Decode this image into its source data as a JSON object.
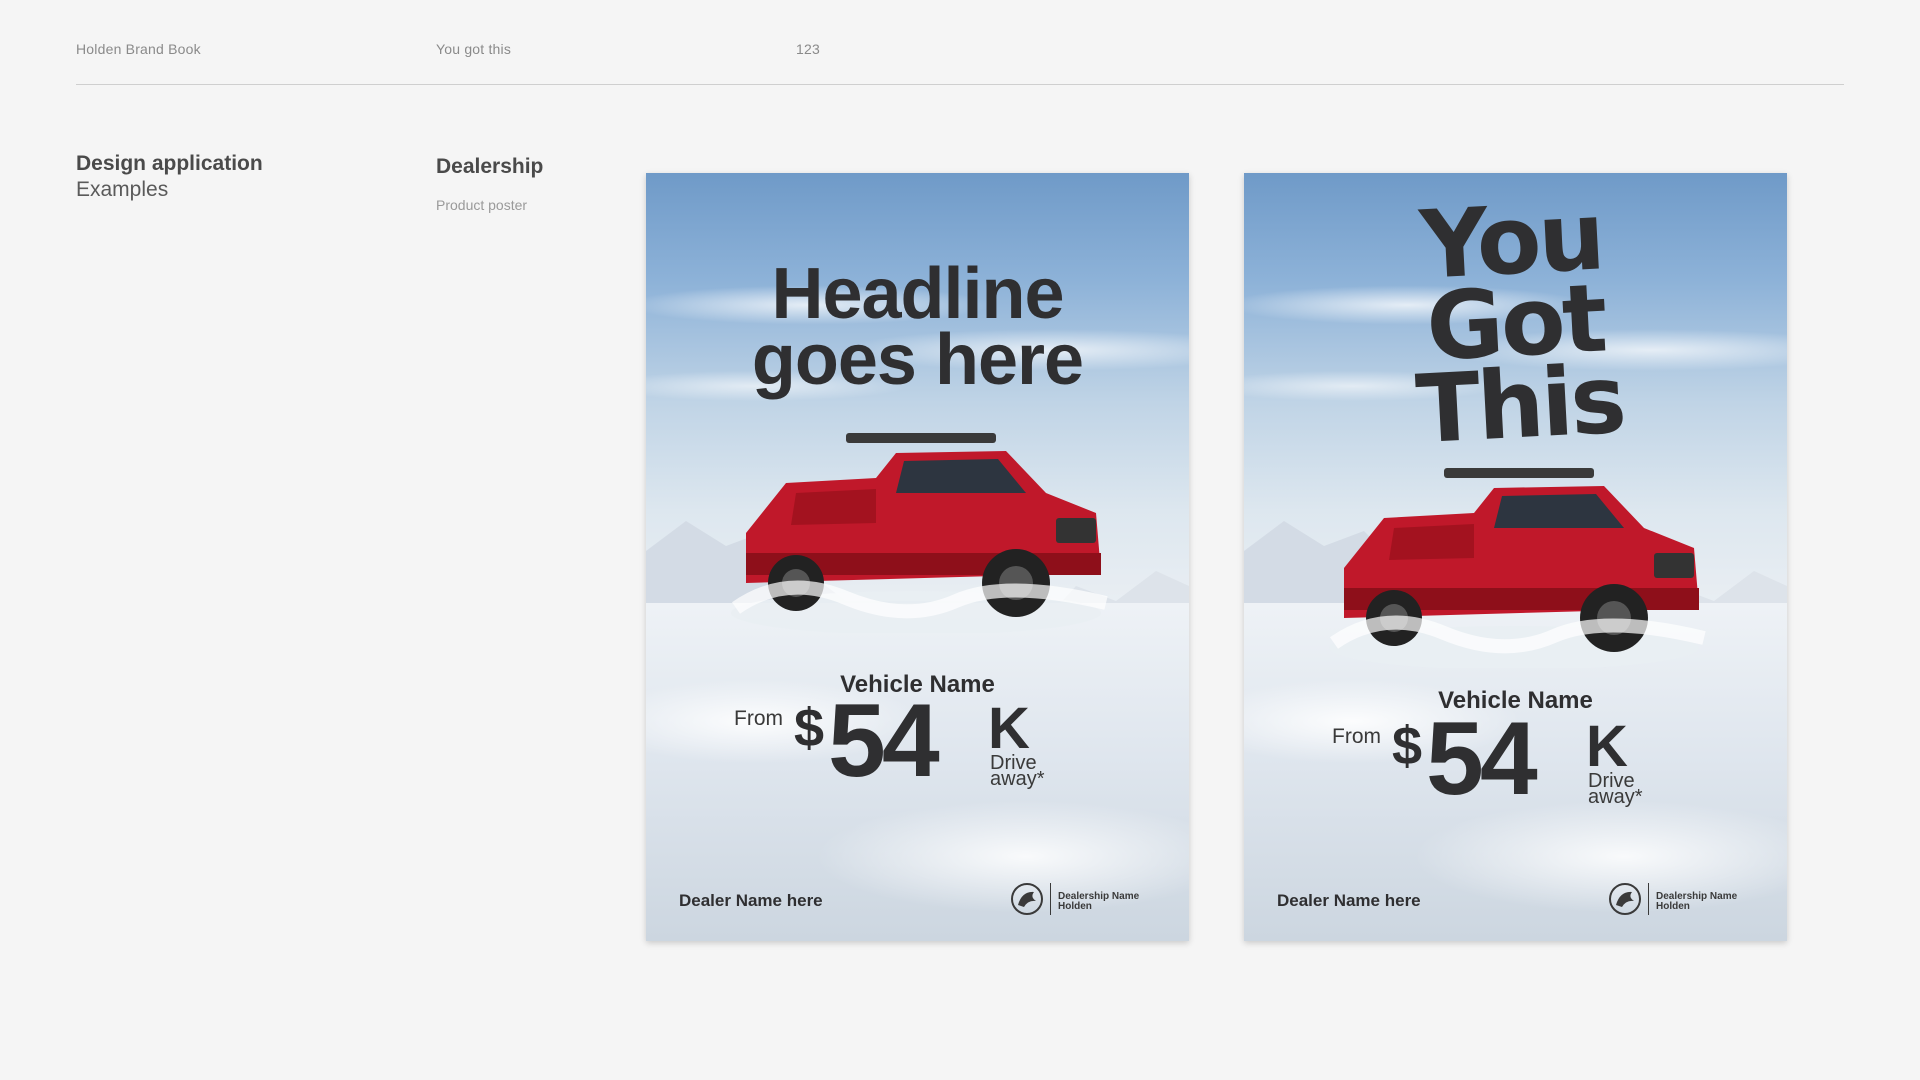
{
  "header": {
    "brand_book": "Holden Brand Book",
    "section": "You got this",
    "page_number": "123"
  },
  "section": {
    "title": "Design application",
    "subtitle": "Examples"
  },
  "subsection": {
    "title": "Dealership",
    "subtitle": "Product poster"
  },
  "posters": [
    {
      "headline_line1": "Headline",
      "headline_line2": "goes here",
      "vehicle_name": "Vehicle Name",
      "from_label": "From",
      "currency": "$",
      "price": "54",
      "suffix": "K",
      "drive_label": "Drive",
      "away_label": "away*",
      "dealer_name": "Dealer Name here",
      "logo_line1": "Dealership Name",
      "logo_line2": "Holden"
    },
    {
      "headline_line1": "You",
      "headline_line2": "Got",
      "headline_line3": "This",
      "vehicle_name": "Vehicle Name",
      "from_label": "From",
      "currency": "$",
      "price": "54",
      "suffix": "K",
      "drive_label": "Drive",
      "away_label": "away*",
      "dealer_name": "Dealer Name here",
      "logo_line1": "Dealership Name",
      "logo_line2": "Holden"
    }
  ],
  "colors": {
    "background": "#f5f5f5",
    "text_dark": "#2f2f31",
    "truck_red": "#c0182a"
  }
}
